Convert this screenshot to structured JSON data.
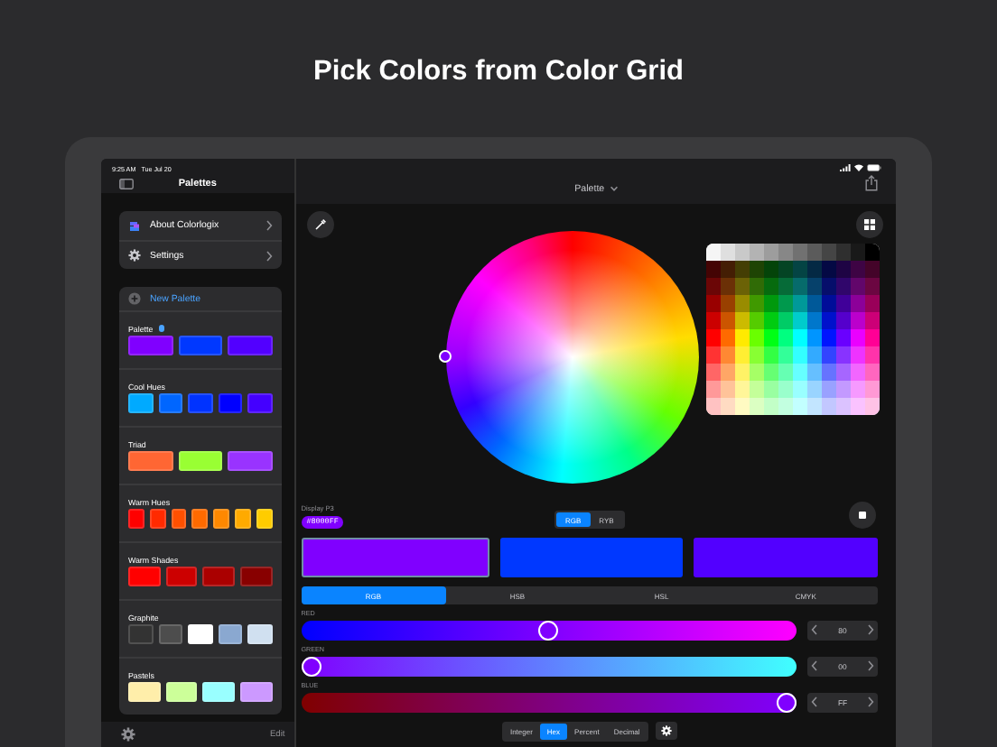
{
  "headline": "Pick Colors from Color Grid",
  "status_bar": {
    "time": "9:25 AM",
    "date": "Tue Jul 20"
  },
  "sidebar": {
    "title": "Palettes",
    "menu": [
      {
        "kind": "app",
        "label": "About Colorlogix"
      },
      {
        "kind": "settings",
        "label": "Settings"
      }
    ],
    "new_palette": "New Palette",
    "palettes": [
      {
        "name": "Palette",
        "selected": true,
        "swatches": [
          {
            "color": "#8000ff"
          },
          {
            "color": "#0038ff"
          },
          {
            "color": "#5200ff"
          }
        ]
      },
      {
        "name": "Cool Hues",
        "selected": false,
        "swatches": [
          {
            "color": "#00aaff"
          },
          {
            "color": "#0066ff"
          },
          {
            "color": "#0033ff"
          },
          {
            "color": "#0000ff"
          },
          {
            "color": "#4400ff"
          }
        ]
      },
      {
        "name": "Triad",
        "selected": false,
        "swatches": [
          {
            "color": "#ff6633"
          },
          {
            "color": "#99ff33"
          },
          {
            "color": "#9933ff"
          }
        ]
      },
      {
        "name": "Warm Hues",
        "selected": false,
        "swatches": [
          {
            "color": "#ff0000"
          },
          {
            "color": "#ff2a00"
          },
          {
            "color": "#ff5000"
          },
          {
            "color": "#ff6a00"
          },
          {
            "color": "#ff8800"
          },
          {
            "color": "#ffaa00"
          },
          {
            "color": "#ffcc00"
          }
        ]
      },
      {
        "name": "Warm Shades",
        "selected": false,
        "swatches": [
          {
            "color": "#ff0000"
          },
          {
            "color": "#cc0000"
          },
          {
            "color": "#aa0000"
          },
          {
            "color": "#880000"
          }
        ]
      },
      {
        "name": "Graphite",
        "selected": false,
        "swatches": [
          {
            "color": "#333333"
          },
          {
            "color": "#4d4d4d"
          },
          {
            "color": "#ffffff"
          },
          {
            "color": "#8aa8d0"
          },
          {
            "color": "#d0e0f0"
          }
        ]
      },
      {
        "name": "Pastels",
        "selected": false,
        "swatches": [
          {
            "color": "#ffeeaa"
          },
          {
            "color": "#ccff99"
          },
          {
            "color": "#99ffff"
          },
          {
            "color": "#cc99ff"
          }
        ]
      }
    ],
    "edit": "Edit"
  },
  "main": {
    "title": "Palette",
    "color_space": "Display P3",
    "hex": "#8000FF",
    "wheel_modes": [
      {
        "label": "RGB",
        "selected": true
      },
      {
        "label": "RYB",
        "selected": false
      }
    ],
    "swatches": [
      {
        "color": "#8000ff",
        "selected": true
      },
      {
        "color": "#0038ff",
        "selected": false
      },
      {
        "color": "#5200ff",
        "selected": false
      }
    ],
    "tabs": [
      {
        "label": "RGB",
        "selected": true
      },
      {
        "label": "HSB",
        "selected": false
      },
      {
        "label": "HSL",
        "selected": false
      },
      {
        "label": "CMYK",
        "selected": false
      }
    ],
    "sliders": [
      {
        "label": "RED",
        "level": 0.5,
        "value": "80"
      },
      {
        "label": "GREEN",
        "level": 0,
        "value": "00"
      },
      {
        "label": "BLUE",
        "level": 1,
        "value": "FF"
      }
    ],
    "formats": [
      {
        "label": "Integer",
        "selected": false
      },
      {
        "label": "Hex",
        "selected": true
      },
      {
        "label": "Percent",
        "selected": false
      },
      {
        "label": "Decimal",
        "selected": false
      }
    ]
  }
}
